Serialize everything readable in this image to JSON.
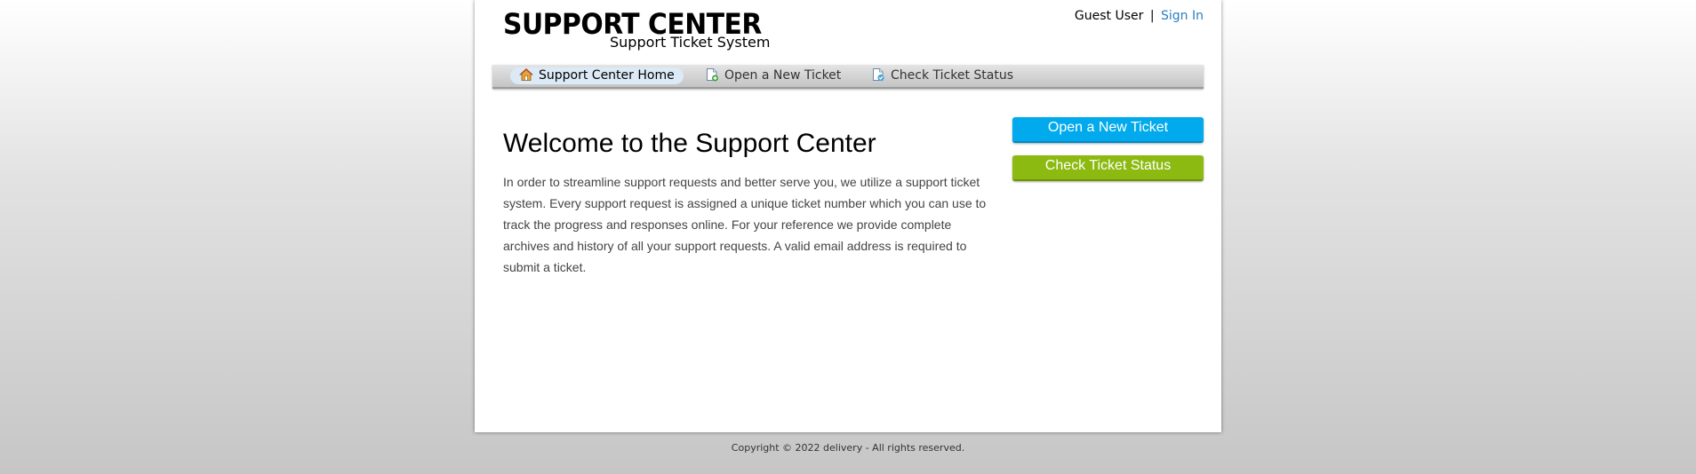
{
  "header": {
    "logo_title": "SUPPORT CENTER",
    "logo_subtitle": "Support Ticket System",
    "user_label": "Guest User",
    "separator": "|",
    "signin_label": "Sign In"
  },
  "nav": {
    "items": [
      {
        "label": "Support Center Home",
        "icon": "home-icon",
        "active": true
      },
      {
        "label": "Open a New Ticket",
        "icon": "new-ticket-icon",
        "active": false
      },
      {
        "label": "Check Ticket Status",
        "icon": "ticket-status-icon",
        "active": false
      }
    ]
  },
  "main": {
    "title": "Welcome to the Support Center",
    "intro": "In order to streamline support requests and better serve you, we utilize a support ticket system. Every support request is assigned a unique ticket number which you can use to track the progress and responses online. For your reference we provide complete archives and history of all your support requests. A valid email address is required to submit a ticket."
  },
  "sidebar": {
    "open_button": "Open a New Ticket",
    "check_button": "Check Ticket Status"
  },
  "colors": {
    "open_button": "#00aaec",
    "check_button": "#8cba11",
    "link": "#2b7fc0"
  },
  "footer": {
    "copyright": "Copyright © 2022 delivery - All rights reserved."
  }
}
